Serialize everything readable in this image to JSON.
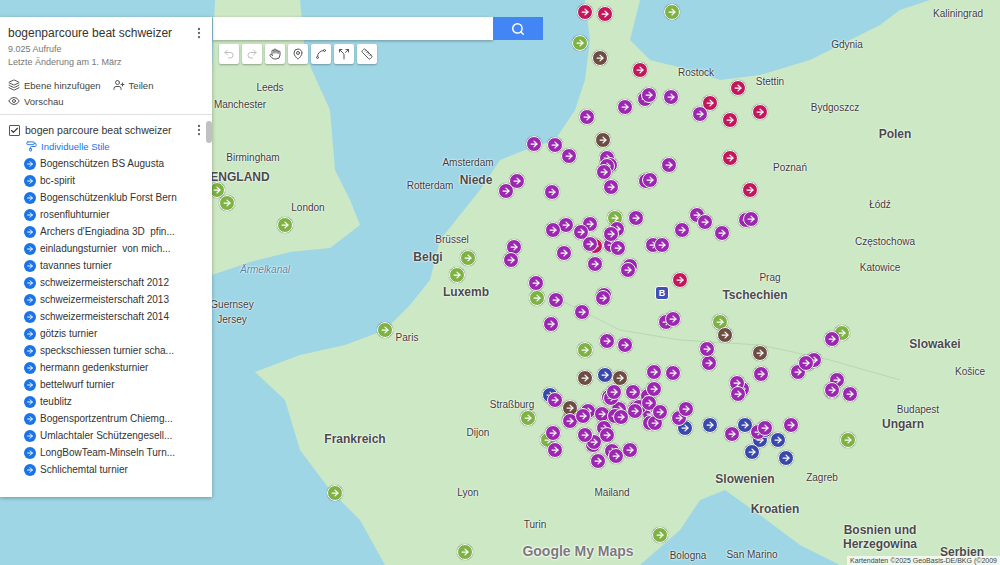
{
  "map": {
    "title": "bogenparcoure beat schweizer",
    "views": "9.025 Aufrufe",
    "last_edit": "Letzte Änderung am 1. März"
  },
  "actions": [
    {
      "kind": "layer",
      "label": "Ebene hinzufügen"
    },
    {
      "kind": "share",
      "label": "Teilen"
    },
    {
      "kind": "preview",
      "label": "Vorschau"
    }
  ],
  "layer": {
    "name": "bogen parcoure beat schweizer",
    "checked": true,
    "style_link": "Individuelle Stile",
    "items": [
      "Bogenschützen BS Augusta",
      "bc-spirit",
      "Bogenschützenklub Forst Bern",
      "rosenfluhturnier",
      "Archers d'Engiadina 3D  pfin...",
      "einladungsturnier  von mich...",
      "tavannes turnier",
      "schweizermeisterschaft 2012",
      "schweizermeisterschaft 2013",
      "schweizermeisterschaft 2014",
      "götzis turnier",
      "speckschiessen turnier scha...",
      "hermann gedenksturnier",
      "bettelwurf turnier",
      "teublitz",
      "Bogensportzentrum Chiemg...",
      "Umlachtaler Schützengesell...",
      "LongBowTeam-Minseln Turn...",
      "Schlichemtal turnier"
    ]
  },
  "tools": [
    {
      "kind": "undo",
      "disabled": true
    },
    {
      "kind": "redo",
      "disabled": true
    },
    {
      "kind": "hand",
      "disabled": false
    },
    {
      "kind": "marker",
      "disabled": false
    },
    {
      "kind": "line",
      "disabled": false
    },
    {
      "kind": "route",
      "disabled": false
    },
    {
      "kind": "ruler",
      "disabled": false
    }
  ],
  "map_labels": [
    {
      "text": "Leeds",
      "kind": "city"
    },
    {
      "text": "Manchester",
      "kind": "city"
    },
    {
      "text": "Birmingham",
      "kind": "city"
    },
    {
      "text": "ENGLAND",
      "kind": "country"
    },
    {
      "text": "London",
      "kind": "city"
    },
    {
      "text": "Amsterdam",
      "kind": "city"
    },
    {
      "text": "Rotterdam",
      "kind": "city"
    },
    {
      "text": "Niede",
      "kind": "country"
    },
    {
      "text": "Brüssel",
      "kind": "city"
    },
    {
      "text": "Belgi",
      "kind": "country"
    },
    {
      "text": "Luxemb",
      "kind": "country"
    },
    {
      "text": "Guernsey",
      "kind": "city"
    },
    {
      "text": "Jersey",
      "kind": "city"
    },
    {
      "text": "Ärmelkanal",
      "kind": "water"
    },
    {
      "text": "Paris",
      "kind": "city"
    },
    {
      "text": "Frankreich",
      "kind": "country"
    },
    {
      "text": "Dijon",
      "kind": "city"
    },
    {
      "text": "Lyon",
      "kind": "city"
    },
    {
      "text": "Turin",
      "kind": "city"
    },
    {
      "text": "Mailand",
      "kind": "city"
    },
    {
      "text": "Bologna",
      "kind": "city"
    },
    {
      "text": "San Marino",
      "kind": "city"
    },
    {
      "text": "Straßburg",
      "kind": "city"
    },
    {
      "text": "Gdynia",
      "kind": "city"
    },
    {
      "text": "Kaliningrad",
      "kind": "city"
    },
    {
      "text": "Rostock",
      "kind": "city"
    },
    {
      "text": "Stettin",
      "kind": "city"
    },
    {
      "text": "Polen",
      "kind": "country"
    },
    {
      "text": "Bydgoszcz",
      "kind": "city"
    },
    {
      "text": "Poznań",
      "kind": "city"
    },
    {
      "text": "Łódź",
      "kind": "city"
    },
    {
      "text": "Częstochowa",
      "kind": "city"
    },
    {
      "text": "Katowice",
      "kind": "city"
    },
    {
      "text": "Prag",
      "kind": "city"
    },
    {
      "text": "Tschechien",
      "kind": "country"
    },
    {
      "text": "Slowakei",
      "kind": "country"
    },
    {
      "text": "Košice",
      "kind": "city"
    },
    {
      "text": "Budapest",
      "kind": "city"
    },
    {
      "text": "Ungarn",
      "kind": "country"
    },
    {
      "text": "Slowenien",
      "kind": "country"
    },
    {
      "text": "Zagreb",
      "kind": "city"
    },
    {
      "text": "Kroatien",
      "kind": "country"
    },
    {
      "text": "Bosnien und Herzegowina",
      "kind": "country"
    },
    {
      "text": "Serbien",
      "kind": "country"
    }
  ],
  "marker": {
    "label": "B"
  },
  "pins": [
    {
      "color": "#7cb342"
    },
    {
      "color": "#7cb342"
    },
    {
      "color": "#7cb342"
    },
    {
      "color": "#7cb342"
    },
    {
      "color": "#7cb342"
    },
    {
      "color": "#7cb342"
    },
    {
      "color": "#7cb342"
    },
    {
      "color": "#7cb342"
    },
    {
      "color": "#7cb342"
    },
    {
      "color": "#7cb342"
    },
    {
      "color": "#7cb342"
    },
    {
      "color": "#7cb342"
    },
    {
      "color": "#7cb342"
    },
    {
      "color": "#7cb342"
    },
    {
      "color": "#7cb342"
    },
    {
      "color": "#7cb342"
    },
    {
      "color": "#7cb342"
    },
    {
      "color": "#7cb342"
    },
    {
      "color": "#7cb342"
    },
    {
      "color": "#7cb342"
    },
    {
      "color": "#c2185b"
    },
    {
      "color": "#c2185b"
    },
    {
      "color": "#c2185b"
    },
    {
      "color": "#c2185b"
    },
    {
      "color": "#c2185b"
    },
    {
      "color": "#c2185b"
    },
    {
      "color": "#c2185b"
    },
    {
      "color": "#c2185b"
    },
    {
      "color": "#c2185b"
    },
    {
      "color": "#c2185b"
    },
    {
      "color": "#c2185b"
    },
    {
      "color": "#3949ab"
    },
    {
      "color": "#3949ab"
    },
    {
      "color": "#3949ab"
    },
    {
      "color": "#3949ab"
    },
    {
      "color": "#3949ab"
    },
    {
      "color": "#3949ab"
    },
    {
      "color": "#3949ab"
    },
    {
      "color": "#3949ab"
    },
    {
      "color": "#3949ab"
    },
    {
      "color": "#3949ab"
    },
    {
      "color": "#6d4c41"
    },
    {
      "color": "#6d4c41"
    },
    {
      "color": "#6d4c41"
    },
    {
      "color": "#6d4c41"
    },
    {
      "color": "#6d4c41"
    },
    {
      "color": "#6d4c41"
    },
    {
      "color": "#6d4c41"
    },
    {
      "color": "#9c27b0"
    },
    {
      "color": "#9c27b0"
    },
    {
      "color": "#9c27b0"
    },
    {
      "color": "#9c27b0"
    },
    {
      "color": "#9c27b0"
    },
    {
      "color": "#9c27b0"
    },
    {
      "color": "#9c27b0"
    },
    {
      "color": "#9c27b0"
    },
    {
      "color": "#9c27b0"
    },
    {
      "color": "#9c27b0"
    },
    {
      "color": "#9c27b0"
    },
    {
      "color": "#9c27b0"
    },
    {
      "color": "#9c27b0"
    },
    {
      "color": "#9c27b0"
    },
    {
      "color": "#9c27b0"
    },
    {
      "color": "#9c27b0"
    },
    {
      "color": "#9c27b0"
    },
    {
      "color": "#9c27b0"
    },
    {
      "color": "#9c27b0"
    },
    {
      "color": "#9c27b0"
    },
    {
      "color": "#9c27b0"
    },
    {
      "color": "#9c27b0"
    },
    {
      "color": "#9c27b0"
    },
    {
      "color": "#9c27b0"
    },
    {
      "color": "#9c27b0"
    },
    {
      "color": "#9c27b0"
    },
    {
      "color": "#9c27b0"
    },
    {
      "color": "#9c27b0"
    },
    {
      "color": "#9c27b0"
    },
    {
      "color": "#9c27b0"
    },
    {
      "color": "#9c27b0"
    },
    {
      "color": "#9c27b0"
    },
    {
      "color": "#9c27b0"
    },
    {
      "color": "#9c27b0"
    },
    {
      "color": "#9c27b0"
    },
    {
      "color": "#9c27b0"
    },
    {
      "color": "#9c27b0"
    },
    {
      "color": "#9c27b0"
    },
    {
      "color": "#9c27b0"
    },
    {
      "color": "#9c27b0"
    },
    {
      "color": "#9c27b0"
    },
    {
      "color": "#9c27b0"
    },
    {
      "color": "#9c27b0"
    },
    {
      "color": "#9c27b0"
    },
    {
      "color": "#9c27b0"
    },
    {
      "color": "#9c27b0"
    },
    {
      "color": "#9c27b0"
    },
    {
      "color": "#9c27b0"
    },
    {
      "color": "#9c27b0"
    },
    {
      "color": "#9c27b0"
    },
    {
      "color": "#9c27b0"
    },
    {
      "color": "#9c27b0"
    },
    {
      "color": "#9c27b0"
    },
    {
      "color": "#9c27b0"
    },
    {
      "color": "#9c27b0"
    },
    {
      "color": "#9c27b0"
    },
    {
      "color": "#9c27b0"
    },
    {
      "color": "#9c27b0"
    },
    {
      "color": "#9c27b0"
    },
    {
      "color": "#9c27b0"
    },
    {
      "color": "#9c27b0"
    },
    {
      "color": "#9c27b0"
    },
    {
      "color": "#9c27b0"
    },
    {
      "color": "#9c27b0"
    },
    {
      "color": "#9c27b0"
    },
    {
      "color": "#9c27b0"
    },
    {
      "color": "#9c27b0"
    },
    {
      "color": "#9c27b0"
    },
    {
      "color": "#9c27b0"
    },
    {
      "color": "#9c27b0"
    },
    {
      "color": "#9c27b0"
    },
    {
      "color": "#9c27b0"
    },
    {
      "color": "#9c27b0"
    },
    {
      "color": "#9c27b0"
    },
    {
      "color": "#9c27b0"
    },
    {
      "color": "#9c27b0"
    },
    {
      "color": "#9c27b0"
    },
    {
      "color": "#9c27b0"
    },
    {
      "color": "#9c27b0"
    },
    {
      "color": "#9c27b0"
    },
    {
      "color": "#9c27b0"
    },
    {
      "color": "#9c27b0"
    },
    {
      "color": "#9c27b0"
    },
    {
      "color": "#9c27b0"
    },
    {
      "color": "#9c27b0"
    },
    {
      "color": "#9c27b0"
    },
    {
      "color": "#9c27b0"
    },
    {
      "color": "#9c27b0"
    },
    {
      "color": "#9c27b0"
    },
    {
      "color": "#9c27b0"
    },
    {
      "color": "#9c27b0"
    },
    {
      "color": "#9c27b0"
    },
    {
      "color": "#9c27b0"
    },
    {
      "color": "#9c27b0"
    },
    {
      "color": "#9c27b0"
    },
    {
      "color": "#9c27b0"
    },
    {
      "color": "#9c27b0"
    },
    {
      "color": "#9c27b0"
    },
    {
      "color": "#9c27b0"
    },
    {
      "color": "#9c27b0"
    },
    {
      "color": "#9c27b0"
    },
    {
      "color": "#9c27b0"
    },
    {
      "color": "#9c27b0"
    },
    {
      "color": "#9c27b0"
    },
    {
      "color": "#9c27b0"
    },
    {
      "color": "#9c27b0"
    },
    {
      "color": "#9c27b0"
    },
    {
      "color": "#9c27b0"
    },
    {
      "color": "#9c27b0"
    },
    {
      "color": "#9c27b0"
    }
  ],
  "attribution": {
    "logo": "Google My Maps",
    "copyright": "Kartendaten ©2025 GeoBasis-DE/BKG (©2009"
  }
}
